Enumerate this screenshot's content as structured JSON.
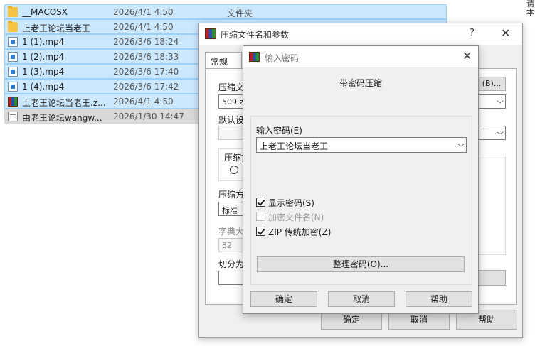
{
  "files": [
    {
      "name": "__MACOSX",
      "date": "2026/4/1 4:50",
      "type": "文件夹",
      "icon": "folder-icon",
      "selection": "blue"
    },
    {
      "name": "上老王论坛当老王",
      "date": "2026/4/1 4:50",
      "type": "",
      "icon": "folder-icon",
      "selection": "blue"
    },
    {
      "name": "1 (1).mp4",
      "date": "2026/3/6 18:24",
      "type": "",
      "icon": "video-file-icon",
      "selection": "blue"
    },
    {
      "name": "1 (2).mp4",
      "date": "2026/3/6 18:33",
      "type": "",
      "icon": "video-file-icon",
      "selection": "blue"
    },
    {
      "name": "1 (3).mp4",
      "date": "2026/3/6 17:40",
      "type": "",
      "icon": "video-file-icon",
      "selection": "blue"
    },
    {
      "name": "1 (4).mp4",
      "date": "2026/3/6 17:42",
      "type": "",
      "icon": "video-file-icon",
      "selection": "blue"
    },
    {
      "name": "上老王论坛当老王.z...",
      "date": "2026/4/1 4:50",
      "type": "",
      "icon": "rar-archive-icon",
      "selection": "blue"
    },
    {
      "name": "由老王论坛wangw...",
      "date": "2026/1/30 14:47",
      "type": "",
      "icon": "text-file-icon",
      "selection": "gray"
    }
  ],
  "edge_text": "请本",
  "back_dialog": {
    "title": "压缩文件名和参数",
    "help": "?",
    "close": "✕",
    "tab_general": "常规",
    "archive_name_label": "压缩文",
    "archive_name_value": "509.zip",
    "browse_button": "(B)...",
    "default_profile_label": "默认设",
    "format_label": "压缩文",
    "method_label": "压缩方",
    "method_value": "标准",
    "dict_label": "字典大",
    "dict_value": "32",
    "split_label": "切分为",
    "ok": "确定",
    "cancel": "取消",
    "help_button": "帮助"
  },
  "password_dialog": {
    "title": "输入密码",
    "close": "✕",
    "heading": "带密码压缩",
    "password_label": "输入密码(E)",
    "password_value": "上老王论坛当老王",
    "show_password": "显示密码(S)",
    "show_password_checked": true,
    "encrypt_names": "加密文件名(N)",
    "encrypt_names_checked": false,
    "zip_legacy": "ZIP 传统加密(Z)",
    "zip_legacy_checked": true,
    "organize_button": "整理密码(O)...",
    "ok": "确定",
    "cancel": "取消",
    "help": "帮助"
  }
}
